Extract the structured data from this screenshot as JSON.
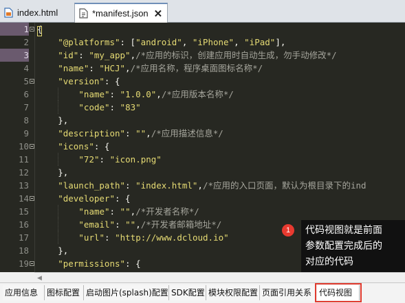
{
  "tabs": [
    {
      "label": "index.html",
      "active": false
    },
    {
      "label": "*manifest.json",
      "active": true
    }
  ],
  "close_glyph": "✕",
  "code_lines": [
    {
      "n": "1",
      "fold": true,
      "hl": true,
      "indent": 0,
      "tokens": [
        [
          "{",
          "#f8f8f2"
        ]
      ]
    },
    {
      "n": "2",
      "indent": 1,
      "tokens": [
        [
          "\"@platforms\"",
          "#e6db74"
        ],
        [
          ": [",
          "#f8f8f2"
        ],
        [
          "\"android\"",
          "#e6db74"
        ],
        [
          ", ",
          "#f8f8f2"
        ],
        [
          "\"iPhone\"",
          "#e6db74"
        ],
        [
          ", ",
          "#f8f8f2"
        ],
        [
          "\"iPad\"",
          "#e6db74"
        ],
        [
          "],",
          "#f8f8f2"
        ]
      ]
    },
    {
      "n": "3",
      "hl": true,
      "indent": 1,
      "tokens": [
        [
          "\"id\"",
          "#e6db74"
        ],
        [
          ": ",
          "#f8f8f2"
        ],
        [
          "\"my_app\"",
          "#e6db74"
        ],
        [
          ",",
          "#f8f8f2"
        ],
        [
          "/*应用的标识，创建应用时自动生成，勿手动修改*/",
          "#a5a59c"
        ]
      ]
    },
    {
      "n": "4",
      "indent": 1,
      "tokens": [
        [
          "\"name\"",
          "#e6db74"
        ],
        [
          ": ",
          "#f8f8f2"
        ],
        [
          "\"HCJ\"",
          "#e6db74"
        ],
        [
          ",",
          "#f8f8f2"
        ],
        [
          "/*应用名称，程序桌面图标名称*/",
          "#a5a59c"
        ]
      ]
    },
    {
      "n": "5",
      "fold": true,
      "indent": 1,
      "tokens": [
        [
          "\"version\"",
          "#e6db74"
        ],
        [
          ": {",
          "#f8f8f2"
        ]
      ]
    },
    {
      "n": "6",
      "indent": 2,
      "tokens": [
        [
          "\"name\"",
          "#e6db74"
        ],
        [
          ": ",
          "#f8f8f2"
        ],
        [
          "\"1.0.0\"",
          "#e6db74"
        ],
        [
          ",",
          "#f8f8f2"
        ],
        [
          "/*应用版本名称*/",
          "#a5a59c"
        ]
      ]
    },
    {
      "n": "7",
      "indent": 2,
      "tokens": [
        [
          "\"code\"",
          "#e6db74"
        ],
        [
          ": ",
          "#f8f8f2"
        ],
        [
          "\"83\"",
          "#e6db74"
        ]
      ]
    },
    {
      "n": "8",
      "indent": 1,
      "tokens": [
        [
          "},",
          "#f8f8f2"
        ]
      ]
    },
    {
      "n": "9",
      "indent": 1,
      "tokens": [
        [
          "\"description\"",
          "#e6db74"
        ],
        [
          ": ",
          "#f8f8f2"
        ],
        [
          "\"\"",
          "#e6db74"
        ],
        [
          ",",
          "#f8f8f2"
        ],
        [
          "/*应用描述信息*/",
          "#a5a59c"
        ]
      ]
    },
    {
      "n": "10",
      "fold": true,
      "indent": 1,
      "tokens": [
        [
          "\"icons\"",
          "#e6db74"
        ],
        [
          ": {",
          "#f8f8f2"
        ]
      ]
    },
    {
      "n": "11",
      "indent": 2,
      "tokens": [
        [
          "\"72\"",
          "#e6db74"
        ],
        [
          ": ",
          "#f8f8f2"
        ],
        [
          "\"icon.png\"",
          "#e6db74"
        ]
      ]
    },
    {
      "n": "12",
      "indent": 1,
      "tokens": [
        [
          "},",
          "#f8f8f2"
        ]
      ]
    },
    {
      "n": "13",
      "indent": 1,
      "tokens": [
        [
          "\"launch_path\"",
          "#e6db74"
        ],
        [
          ": ",
          "#f8f8f2"
        ],
        [
          "\"index.html\"",
          "#e6db74"
        ],
        [
          ",",
          "#f8f8f2"
        ],
        [
          "/*应用的入口页面，默认为根目录下的ind",
          "#a5a59c"
        ]
      ]
    },
    {
      "n": "14",
      "fold": true,
      "indent": 1,
      "tokens": [
        [
          "\"developer\"",
          "#e6db74"
        ],
        [
          ": {",
          "#f8f8f2"
        ]
      ]
    },
    {
      "n": "15",
      "indent": 2,
      "tokens": [
        [
          "\"name\"",
          "#e6db74"
        ],
        [
          ": ",
          "#f8f8f2"
        ],
        [
          "\"\"",
          "#e6db74"
        ],
        [
          ",",
          "#f8f8f2"
        ],
        [
          "/*开发者名称*/",
          "#a5a59c"
        ]
      ]
    },
    {
      "n": "16",
      "indent": 2,
      "tokens": [
        [
          "\"email\"",
          "#e6db74"
        ],
        [
          ": ",
          "#f8f8f2"
        ],
        [
          "\"\"",
          "#e6db74"
        ],
        [
          ",",
          "#f8f8f2"
        ],
        [
          "/*开发者邮箱地址*/",
          "#a5a59c"
        ]
      ]
    },
    {
      "n": "17",
      "indent": 2,
      "tokens": [
        [
          "\"url\"",
          "#e6db74"
        ],
        [
          ": ",
          "#f8f8f2"
        ],
        [
          "\"http://www.dcloud.io\"",
          "#e6db74"
        ]
      ]
    },
    {
      "n": "18",
      "indent": 1,
      "tokens": [
        [
          "},",
          "#f8f8f2"
        ]
      ]
    },
    {
      "n": "19",
      "fold": true,
      "indent": 1,
      "tokens": [
        [
          "\"permissions\"",
          "#e6db74"
        ],
        [
          ": {",
          "#f8f8f2"
        ]
      ]
    }
  ],
  "callout": {
    "badge": "1",
    "lines": [
      "代码视图就是前面",
      "参数配置完成后的",
      "对应的代码"
    ]
  },
  "view_tabs": [
    {
      "label": "应用信息"
    },
    {
      "label": "图标配置"
    },
    {
      "label": "启动图片(splash)配置"
    },
    {
      "label": "SDK配置"
    },
    {
      "label": "模块权限配置"
    },
    {
      "label": "页面引用关系"
    },
    {
      "label": "代码视图",
      "selected": true
    }
  ],
  "colors": {
    "editor_bg": "#272822",
    "string": "#e6db74",
    "punct": "#f8f8f2",
    "comment": "#a5a59c",
    "highlight_line": "#6a5a6e",
    "annotation_red": "#e03a2e"
  }
}
